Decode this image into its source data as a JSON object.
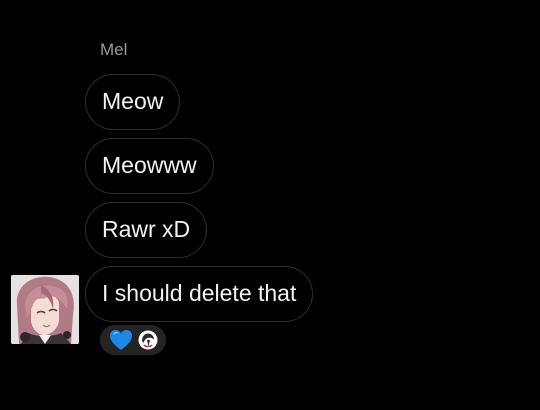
{
  "conversation": {
    "sender_name": "Mel",
    "messages": [
      {
        "text": "Meow"
      },
      {
        "text": "Meowww"
      },
      {
        "text": "Rawr xD"
      },
      {
        "text": "I should delete that"
      }
    ],
    "avatar": {
      "icon": "anime-character-avatar"
    },
    "reactions": [
      {
        "icon": "blue-heart-icon",
        "color": "#1e88e5"
      },
      {
        "icon": "reactor-avatar-icon"
      }
    ]
  }
}
